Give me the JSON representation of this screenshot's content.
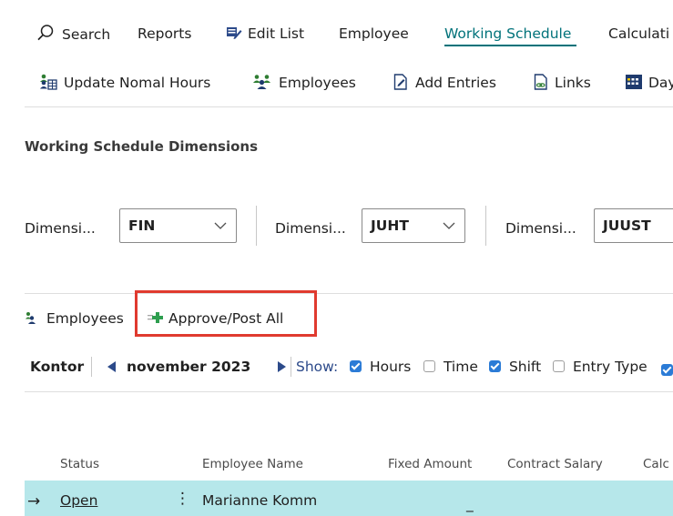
{
  "nav": {
    "search": "Search",
    "reports": "Reports",
    "edit_list": "Edit List",
    "employee": "Employee",
    "working_schedule": "Working Schedule",
    "calculation": "Calculati"
  },
  "toolbar": {
    "update_hours": "Update Nomal Hours",
    "employees": "Employees",
    "add_entries": "Add Entries",
    "links": "Links",
    "day": "Day"
  },
  "section": {
    "title": "Working Schedule Dimensions"
  },
  "dimensions": [
    {
      "label": "Dimensi...",
      "value": "FIN"
    },
    {
      "label": "Dimensi...",
      "value": "JUHT"
    },
    {
      "label": "Dimensi...",
      "value": "JUUST"
    }
  ],
  "subpage_actions": {
    "employees": "Employees",
    "approve_post_all": "Approve/Post All"
  },
  "filter_bar": {
    "location": "Kontor",
    "month": "november 2023",
    "show_label": "Show:",
    "options": [
      {
        "label": "Hours",
        "checked": true
      },
      {
        "label": "Time",
        "checked": false
      },
      {
        "label": "Shift",
        "checked": true
      },
      {
        "label": "Entry Type",
        "checked": false
      }
    ]
  },
  "table": {
    "columns": [
      "Status",
      "Employee Name",
      "Fixed Amount",
      "Contract Salary",
      "Calc"
    ],
    "rows": [
      {
        "status": "Open",
        "employee_name": "Marianne Komm",
        "fixed_amount": "_"
      }
    ]
  },
  "colors": {
    "accent": "#00727a",
    "highlight_box": "#e03a2f",
    "selected_row": "#b6e7ea",
    "checkbox": "#2b7bd6"
  }
}
